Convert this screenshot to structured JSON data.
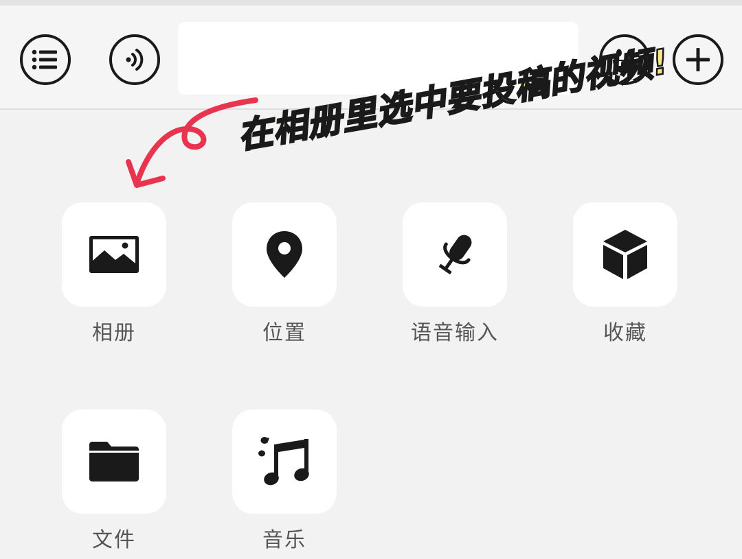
{
  "toolbar": {
    "input_value": "",
    "buttons": {
      "menu_icon": "list-icon",
      "voice_icon": "voice-icon",
      "emoji_icon": "emoji-icon",
      "plus_icon": "plus-icon"
    }
  },
  "annotation": {
    "text": "在相册里选中要投稿的视频!",
    "text_color": "#f8e58c",
    "arrow_color": "#e8344e"
  },
  "panel": {
    "items": [
      {
        "label": "相册",
        "icon": "image-icon"
      },
      {
        "label": "位置",
        "icon": "location-pin-icon"
      },
      {
        "label": "语音输入",
        "icon": "microphone-icon"
      },
      {
        "label": "收藏",
        "icon": "cube-icon"
      },
      {
        "label": "文件",
        "icon": "folder-icon"
      },
      {
        "label": "音乐",
        "icon": "music-note-icon"
      }
    ]
  }
}
